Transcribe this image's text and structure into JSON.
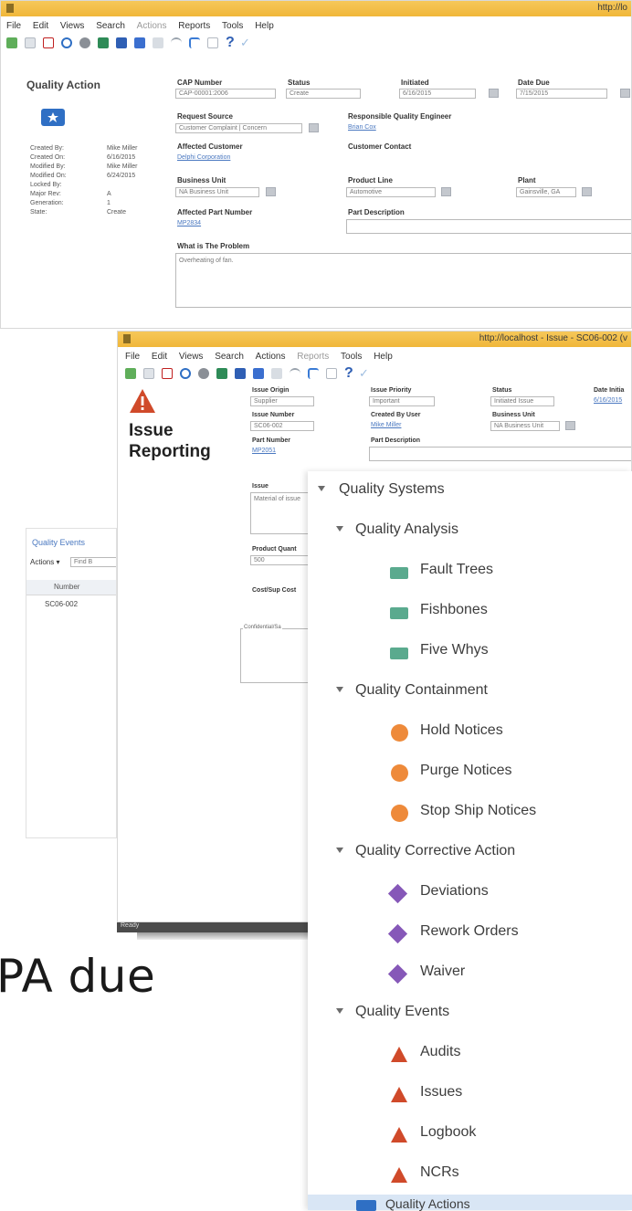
{
  "window1": {
    "url": "http://lo",
    "menu": [
      "File",
      "Edit",
      "Views",
      "Search",
      "Actions",
      "Reports",
      "Tools",
      "Help"
    ],
    "section_title": "Quality Action",
    "meta_labels": [
      "Created By:",
      "Created On:",
      "Modified By:",
      "Modified On:",
      "Locked By:",
      "Major Rev:",
      "Generation:",
      "State:"
    ],
    "meta_values": [
      "Mike Miller",
      "6/16/2015",
      "Mike Miller",
      "6/24/2015",
      "",
      "A",
      "1",
      "Create"
    ],
    "capa_number_label": "CAP Number",
    "capa_number_value": "CAP-00001:2006",
    "status_label": "Status",
    "status_value": "Create",
    "initiated_label": "Initiated",
    "initiated_value": "6/16/2015",
    "date_due_label": "Date Due",
    "date_due_value": "7/15/2015",
    "request_source_label": "Request Source",
    "request_source_value": "Customer Complaint | Concern",
    "responsible_label": "Responsible Quality Engineer",
    "responsible_value": "Brian Cox",
    "affected_customer_label": "Affected Customer",
    "affected_customer_value": "Delphi Corporation",
    "customer_contact_label": "Customer Contact",
    "business_unit_label": "Business Unit",
    "business_unit_value": "NA Business Unit",
    "product_line_label": "Product Line",
    "product_line_value": "Automotive",
    "plant_label": "Plant",
    "plant_value": "Gainsville, GA",
    "affected_part_label": "Affected Part Number",
    "affected_part_value": "MP2834",
    "part_description_label": "Part Description",
    "problem_label": "What is The Problem",
    "problem_value": "Overheating of fan."
  },
  "events_panel": {
    "tab": "Quality Events",
    "actions_label": "Actions",
    "find_placeholder": "Find B",
    "column_header": "Number",
    "rows": [
      "SC06-002"
    ],
    "status": "Ready"
  },
  "window2": {
    "url": "http://localhost - Issue - SC06-002 (v",
    "menu": [
      "File",
      "Edit",
      "Views",
      "Search",
      "Actions",
      "Reports",
      "Tools",
      "Help"
    ],
    "title_line1": "Issue",
    "title_line2": "Reporting",
    "issue_origin_label": "Issue Origin",
    "issue_origin_value": "Supplier",
    "issue_priority_label": "Issue Priority",
    "issue_priority_value": "Important",
    "status_label": "Status",
    "status_value": "Initiated Issue",
    "date_initiated_label": "Date Initia",
    "date_initiated_value": "6/16/2015",
    "issue_number_label": "Issue Number",
    "issue_number_value": "SC06-002",
    "created_by_label": "Created By User",
    "created_by_value": "Mike Miller",
    "business_unit_label": "Business Unit",
    "business_unit_value": "NA Business Unit",
    "part_number_label": "Part Number",
    "part_number_value": "MP2051",
    "part_description_label": "Part Description",
    "issue_label": "Issue",
    "issue_value": "Material of issue",
    "product_quantity_label": "Product Quant",
    "product_quantity_value": "500",
    "cost_label": "Cost/Sup Cost",
    "confidential_label": "Confidential/Sa"
  },
  "big_text": "PA due",
  "nav_tree": {
    "root": "Quality Systems",
    "groups": [
      {
        "label": "Quality Analysis",
        "items": [
          "Fault Trees",
          "Fishbones",
          "Five Whys"
        ],
        "icon_color": "#5aaa8e",
        "icon": "green-square-icon"
      },
      {
        "label": "Quality Containment",
        "items": [
          "Hold Notices",
          "Purge Notices",
          "Stop Ship Notices"
        ],
        "icon_color": "#ee8a3a",
        "icon": "orange-circle-icon"
      },
      {
        "label": "Quality Corrective Action",
        "items": [
          "Deviations",
          "Rework Orders",
          "Waiver"
        ],
        "icon_color": "#8658b8",
        "icon": "purple-diamond-icon"
      },
      {
        "label": "Quality Events",
        "items": [
          "Audits",
          "Issues",
          "Logbook",
          "NCRs"
        ],
        "icon_color": "#d04a2a",
        "icon": "red-triangle-icon"
      }
    ],
    "selected": "Quality Actions",
    "selected_icon_color": "#2f6fc4"
  }
}
